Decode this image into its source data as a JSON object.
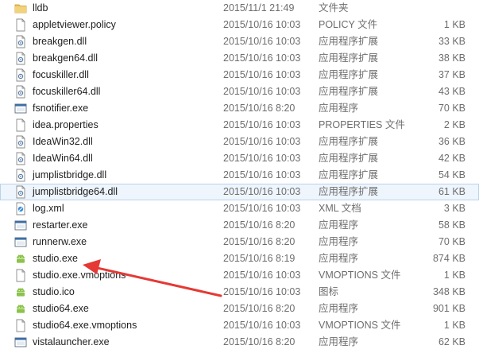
{
  "files": [
    {
      "name": "lldb",
      "date": "2015/11/1 21:49",
      "type": "文件夹",
      "size": "",
      "icon": "folder-icon"
    },
    {
      "name": "appletviewer.policy",
      "date": "2015/10/16 10:03",
      "type": "POLICY 文件",
      "size": "1 KB",
      "icon": "generic-file-icon"
    },
    {
      "name": "breakgen.dll",
      "date": "2015/10/16 10:03",
      "type": "应用程序扩展",
      "size": "33 KB",
      "icon": "dll-file-icon"
    },
    {
      "name": "breakgen64.dll",
      "date": "2015/10/16 10:03",
      "type": "应用程序扩展",
      "size": "38 KB",
      "icon": "dll-file-icon"
    },
    {
      "name": "focuskiller.dll",
      "date": "2015/10/16 10:03",
      "type": "应用程序扩展",
      "size": "37 KB",
      "icon": "dll-file-icon"
    },
    {
      "name": "focuskiller64.dll",
      "date": "2015/10/16 10:03",
      "type": "应用程序扩展",
      "size": "43 KB",
      "icon": "dll-file-icon"
    },
    {
      "name": "fsnotifier.exe",
      "date": "2015/10/16 8:20",
      "type": "应用程序",
      "size": "70 KB",
      "icon": "exe-window-icon"
    },
    {
      "name": "idea.properties",
      "date": "2015/10/16 10:03",
      "type": "PROPERTIES 文件",
      "size": "2 KB",
      "icon": "generic-file-icon"
    },
    {
      "name": "IdeaWin32.dll",
      "date": "2015/10/16 10:03",
      "type": "应用程序扩展",
      "size": "36 KB",
      "icon": "dll-file-icon"
    },
    {
      "name": "IdeaWin64.dll",
      "date": "2015/10/16 10:03",
      "type": "应用程序扩展",
      "size": "42 KB",
      "icon": "dll-file-icon"
    },
    {
      "name": "jumplistbridge.dll",
      "date": "2015/10/16 10:03",
      "type": "应用程序扩展",
      "size": "54 KB",
      "icon": "dll-file-icon"
    },
    {
      "name": "jumplistbridge64.dll",
      "date": "2015/10/16 10:03",
      "type": "应用程序扩展",
      "size": "61 KB",
      "icon": "dll-file-icon",
      "selected": true
    },
    {
      "name": "log.xml",
      "date": "2015/10/16 10:03",
      "type": "XML 文档",
      "size": "3 KB",
      "icon": "xml-file-icon"
    },
    {
      "name": "restarter.exe",
      "date": "2015/10/16 8:20",
      "type": "应用程序",
      "size": "58 KB",
      "icon": "exe-window-icon"
    },
    {
      "name": "runnerw.exe",
      "date": "2015/10/16 8:20",
      "type": "应用程序",
      "size": "70 KB",
      "icon": "exe-window-icon"
    },
    {
      "name": "studio.exe",
      "date": "2015/10/16 8:19",
      "type": "应用程序",
      "size": "874 KB",
      "icon": "android-icon"
    },
    {
      "name": "studio.exe.vmoptions",
      "date": "2015/10/16 10:03",
      "type": "VMOPTIONS 文件",
      "size": "1 KB",
      "icon": "generic-file-icon"
    },
    {
      "name": "studio.ico",
      "date": "2015/10/16 10:03",
      "type": "图标",
      "size": "348 KB",
      "icon": "android-icon"
    },
    {
      "name": "studio64.exe",
      "date": "2015/10/16 8:20",
      "type": "应用程序",
      "size": "901 KB",
      "icon": "android-icon"
    },
    {
      "name": "studio64.exe.vmoptions",
      "date": "2015/10/16 10:03",
      "type": "VMOPTIONS 文件",
      "size": "1 KB",
      "icon": "generic-file-icon"
    },
    {
      "name": "vistalauncher.exe",
      "date": "2015/10/16 8:20",
      "type": "应用程序",
      "size": "62 KB",
      "icon": "exe-window-icon"
    }
  ],
  "annotation": {
    "arrow_color": "#e53935",
    "target": "studio.exe"
  },
  "colors": {
    "selected_bg": "#eef5fc",
    "selected_border": "#b9d3ea",
    "folder": "#e8c15a",
    "android": "#8bc34a",
    "muted_text": "#6d6d6d"
  }
}
